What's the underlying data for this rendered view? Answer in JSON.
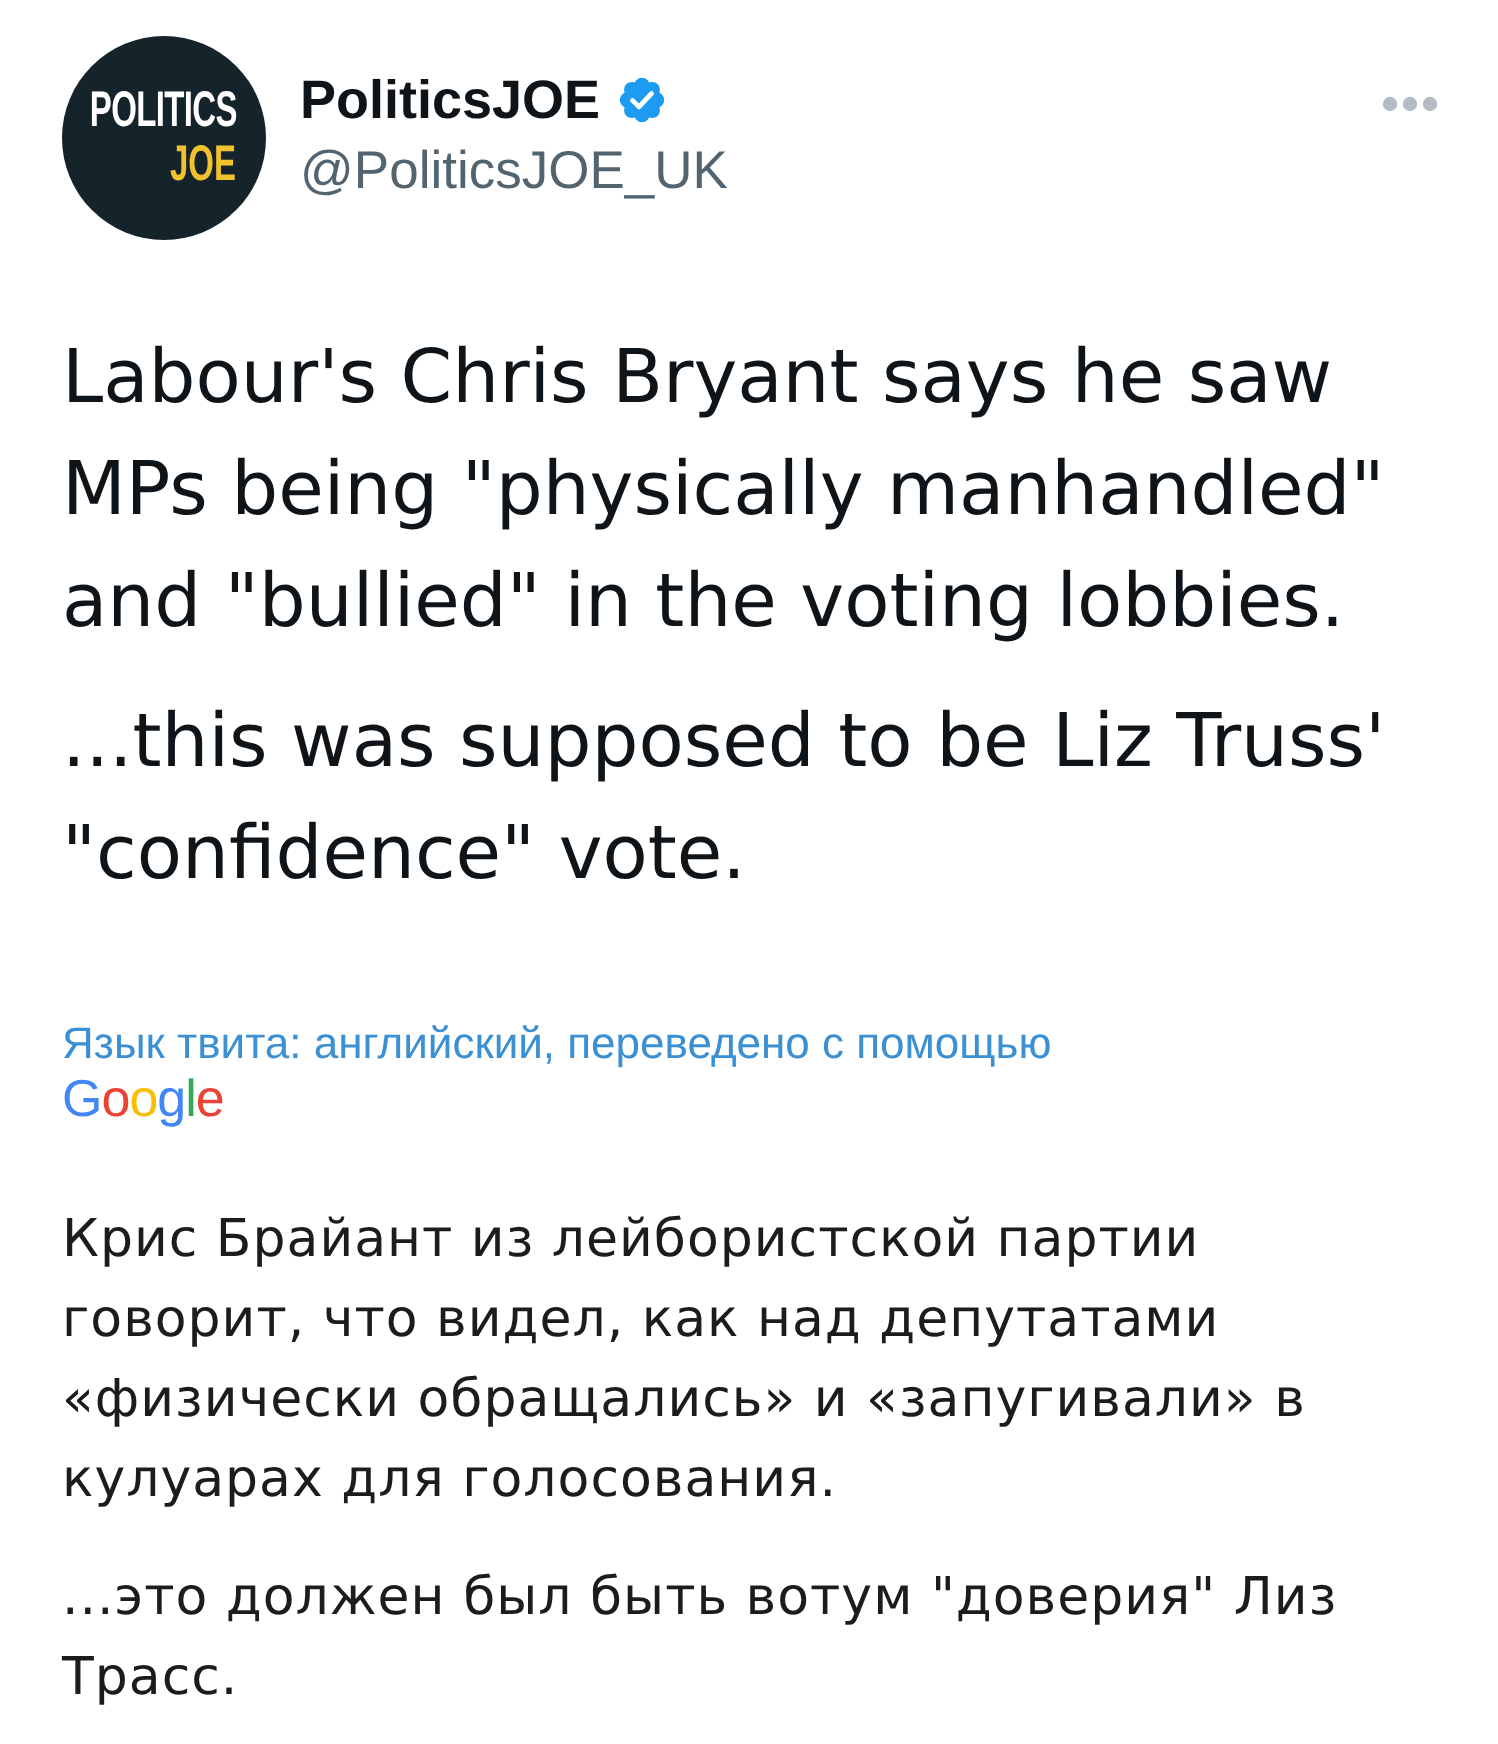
{
  "tweet": {
    "author": {
      "avatar": {
        "line_1": "POLITICS",
        "line_2": "JOE"
      },
      "name": "PoliticsJOE",
      "verified": true,
      "handle": "@PoliticsJOE_UK"
    },
    "paragraphs": [
      "Labour's Chris Bryant says he saw MPs being \"physically manhandled\" and \"bullied\" in the voting lobbies.",
      "...this was supposed to be Liz Truss' \"confidence\" vote."
    ],
    "translation": {
      "label": "Язык твита: английский, переведено с помощью",
      "provider": "Google",
      "paragraphs": [
        "Крис Брайант из лейбористской партии говорит, что видел, как над депутатами «физически обращались» и «запугивали» в кулуарах для голосования.",
        "...это должен был быть вотум \"доверия\" Лиз Трасс."
      ]
    }
  }
}
